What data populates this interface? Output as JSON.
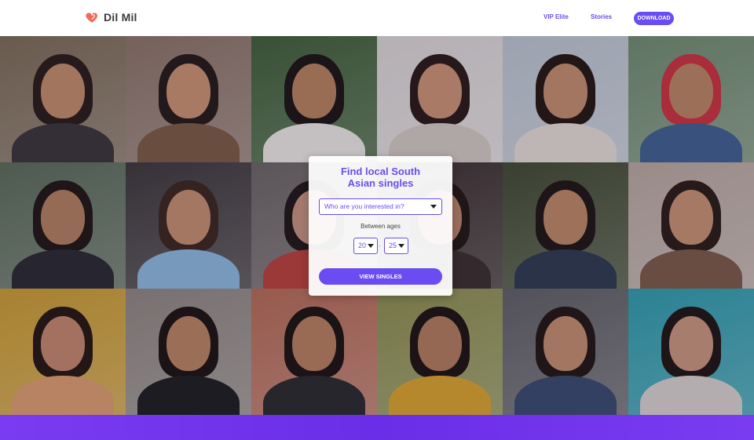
{
  "header": {
    "logo_text": "Dil Mil",
    "nav": {
      "vip_label": "VIP Elite",
      "stories_label": "Stories",
      "download_label": "DOWNLOAD"
    }
  },
  "card": {
    "title_line1": "Find local South",
    "title_line2": "Asian singles",
    "interest_select": "Who are you interested in?",
    "ages_label": "Between ages",
    "age_min": "20",
    "age_max": "25",
    "submit_label": "VIEW SINGLES"
  },
  "colors": {
    "brand_purple": "#6a4df2",
    "logo_heart": "#f06a5a",
    "footer_purple": "#7a3cf0"
  },
  "photos": [
    {
      "name": "profile-photo-1",
      "bg": "#7b6a52",
      "skin": "#c08a66",
      "hair": "#2a1c16",
      "cloth": "#3a3535"
    },
    {
      "name": "profile-photo-2",
      "bg": "#8a7263",
      "skin": "#c9906c",
      "hair": "#241a15",
      "cloth": "#7b5a40"
    },
    {
      "name": "profile-photo-3",
      "bg": "#3f5e34",
      "skin": "#b57f5a",
      "hair": "#1c1410",
      "cloth": "#e9e6e0"
    },
    {
      "name": "profile-photo-4",
      "bg": "#d8d3cf",
      "skin": "#c89070",
      "hair": "#2a1a14",
      "cloth": "#cfc7bd"
    },
    {
      "name": "profile-photo-5",
      "bg": "#b9c2c9",
      "skin": "#c18c6a",
      "hair": "#24170f",
      "cloth": "#e2d8d0"
    },
    {
      "name": "profile-photo-6",
      "bg": "#6f8a6b",
      "skin": "#b9845e",
      "hair": "#c8323b",
      "cloth": "#3f5f8c"
    },
    {
      "name": "profile-photo-7",
      "bg": "#5a6a55",
      "skin": "#b07e5c",
      "hair": "#1f1612",
      "cloth": "#2a2a2e"
    },
    {
      "name": "profile-photo-8",
      "bg": "#3d3837",
      "skin": "#c28d6c",
      "hair": "#3b271c",
      "cloth": "#8bb7d8"
    },
    {
      "name": "profile-photo-9",
      "bg": "#6a6360",
      "skin": "#c3907a",
      "hair": "#1f1613",
      "cloth": "#b84038"
    },
    {
      "name": "profile-photo-10",
      "bg": "#3b2f2b",
      "skin": "#b88262",
      "hair": "#20160f",
      "cloth": "#3a2f2a"
    },
    {
      "name": "profile-photo-11",
      "bg": "#414a2e",
      "skin": "#bb8662",
      "hair": "#1e1510",
      "cloth": "#2e3a4a"
    },
    {
      "name": "profile-photo-12",
      "bg": "#b6a69a",
      "skin": "#c48f6c",
      "hair": "#2a1b13",
      "cloth": "#7a5a44"
    },
    {
      "name": "profile-photo-13",
      "bg": "#c89a2e",
      "skin": "#c2866a",
      "hair": "#24170f",
      "cloth": "#d99b6b"
    },
    {
      "name": "profile-photo-14",
      "bg": "#8d857c",
      "skin": "#b8825e",
      "hair": "#1b130e",
      "cloth": "#1e1e1e"
    },
    {
      "name": "profile-photo-15",
      "bg": "#b36a52",
      "skin": "#b57d5a",
      "hair": "#1b130e",
      "cloth": "#2a2a2a"
    },
    {
      "name": "profile-photo-16",
      "bg": "#8a8d4a",
      "skin": "#b07a58",
      "hair": "#1c130e",
      "cloth": "#d8a12a"
    },
    {
      "name": "profile-photo-17",
      "bg": "#5f5f60",
      "skin": "#c08b6a",
      "hair": "#23170f",
      "cloth": "#3a4a6a"
    },
    {
      "name": "profile-photo-18",
      "bg": "#2f9aa6",
      "skin": "#c69478",
      "hair": "#1f1510",
      "cloth": "#d6cfc9"
    }
  ]
}
